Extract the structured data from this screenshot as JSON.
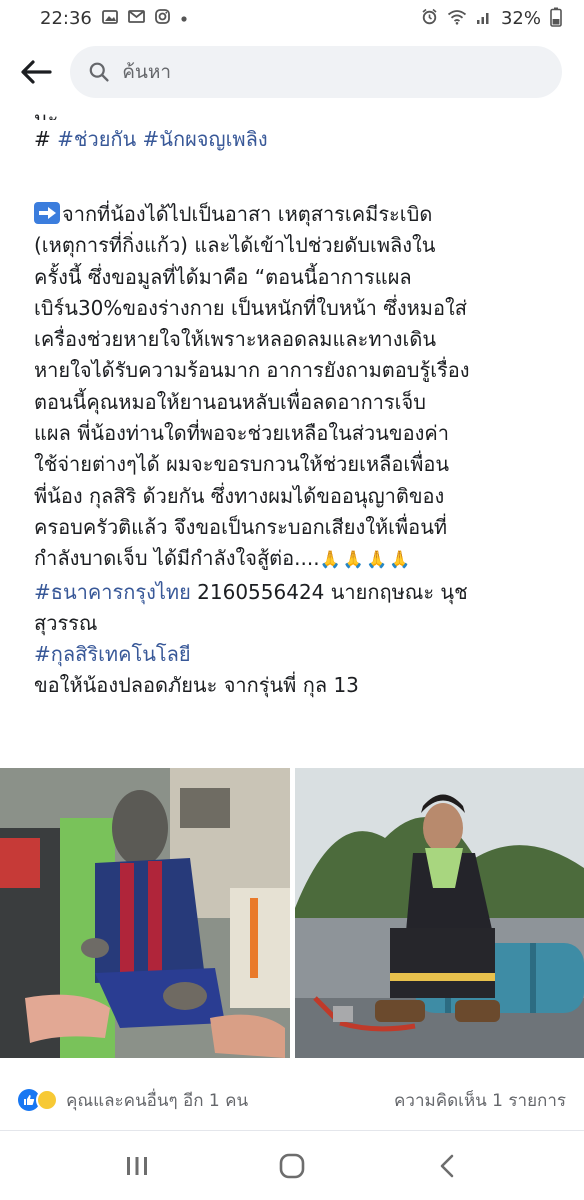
{
  "status_bar": {
    "time": "22:36",
    "left_icons": [
      "gallery-icon",
      "gmail-icon",
      "instagram-icon",
      "dot-icon"
    ],
    "right_icons": [
      "alarm-icon",
      "wifi-icon",
      "signal-icon"
    ],
    "battery": "32%"
  },
  "search": {
    "placeholder": "ค้นหา"
  },
  "post": {
    "clipped_top": "นะ",
    "hashtags_line": {
      "hash": "#",
      "tag1": "#ช่วยกัน",
      "tag2": "#นักผจญเพลิง"
    },
    "body_lines": [
      "จากที่น้องได้ไปเป็นอาสา เหตุสารเคมีระเบิด",
      "(เหตุการที่กิ่งแก้ว) และได้เข้าไปช่วยดับเพลิงใน",
      "ครั้งนี้ ซึ่งขอมูลที่ได้มาคือ “ตอนนี้อาการแผล",
      "เบิร์น30%ของร่างกาย เป็นหนักที่ใบหน้า ซึ่งหมอใส่",
      "เครื่องช่วยหายใจให้เพราะหลอดลมและทางเดิน",
      "หายใจได้รับความร้อนมาก อาการยังถามตอบรู้เรื่อง",
      "ตอนนี้คุณหมอให้ยานอนหลับเพื่อลดอาการเจ็บ",
      "แผล พี่น้องท่านใดที่พอจะช่วยเหลือในส่วนของค่า",
      "ใช้จ่ายต่างๆได้  ผมจะขอรบกวนให้ช่วยเหลือเพื่อน",
      "พี่น้อง กุลสิริ ด้วยกัน  ซึ่งทางผมได้ขออนุญาติของ",
      "ครอบครัวติแล้ว จึงขอเป็นกระบอกเสียงให้เพื่อนที่",
      "กำลังบาดเจ็บ ได้มีกำลังใจสู้ต่อ...."
    ],
    "pray_emoji": "🙏🙏🙏🙏",
    "bank_tag": "#ธนาคารกรุงไทย",
    "bank_account": " 2160556424  นายกฤษณะ นุช",
    "bank_name_cont": "สุวรรณ",
    "school_tag": "#กุลสิริเทคโนโลยี",
    "closing": "ขอให้น้องปลอดภัยนะ จากรุ่นพี่ กุล 13"
  },
  "photos": [
    {
      "subject": "injured-patient-photo"
    },
    {
      "subject": "firefighter-portrait-photo"
    }
  ],
  "reactions": {
    "summary": "คุณและคนอื่นๆ อีก 1 คน",
    "comments": "ความคิดเห็น 1 รายการ",
    "like_color": "#1877f2",
    "sad_color": "#f7c935"
  },
  "nav": {
    "buttons": [
      "recents-icon",
      "home-icon",
      "back-icon"
    ]
  },
  "colors": {
    "link": "#385898",
    "text": "#1c1e21",
    "muted": "#65676b"
  }
}
